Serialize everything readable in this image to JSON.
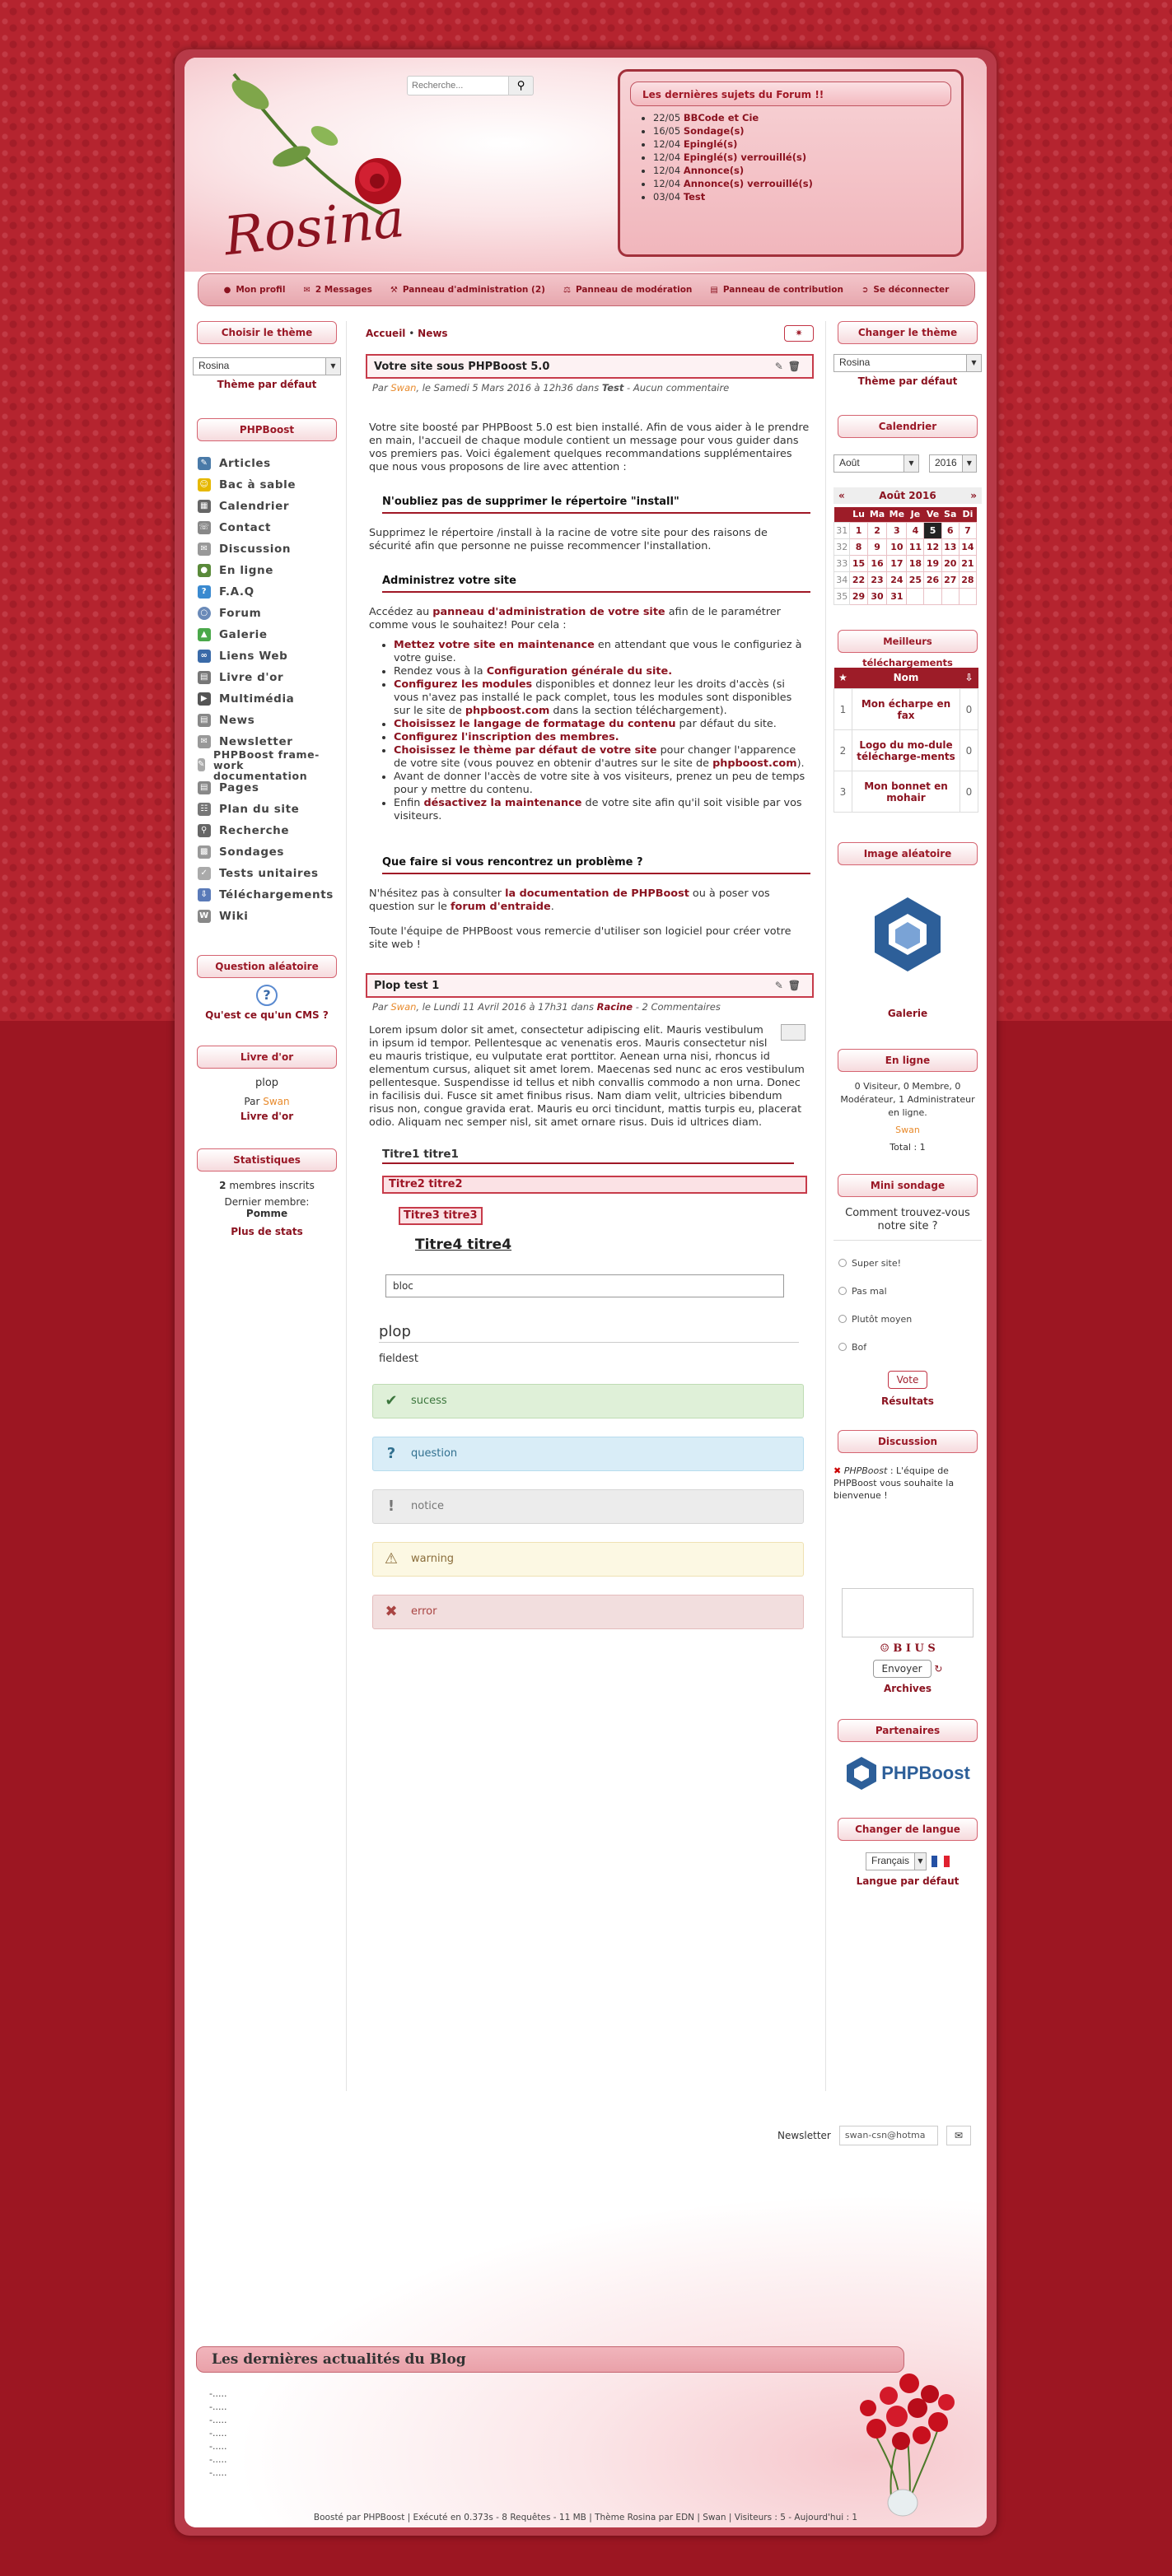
{
  "header": {
    "logo": "Rosina",
    "search_placeholder": "Recherche...",
    "forum_title": "Les dernières sujets du Forum !!",
    "forum_items": [
      {
        "date": "22/05",
        "title": "BBCode et Cie"
      },
      {
        "date": "16/05",
        "title": "Sondage(s)"
      },
      {
        "date": "12/04",
        "title": "Epinglé(s)"
      },
      {
        "date": "12/04",
        "title": "Epinglé(s) verrouillé(s)"
      },
      {
        "date": "12/04",
        "title": "Annonce(s)"
      },
      {
        "date": "12/04",
        "title": "Annonce(s) verrouillé(s)"
      },
      {
        "date": "03/04",
        "title": "Test"
      }
    ]
  },
  "navbar": {
    "items": [
      "Mon profil",
      "2 Messages",
      "Panneau d'administration (2)",
      "Panneau de modération",
      "Panneau de contribution",
      "Se déconnecter"
    ]
  },
  "left": {
    "theme_title": "Choisir le thème",
    "theme_value": "Rosina",
    "theme_default": "Thème par défaut",
    "phpboost_title": "PHPBoost",
    "menu": [
      "Articles",
      "Bac à sable",
      "Calendrier",
      "Contact",
      "Discussion",
      "En ligne",
      "F.A.Q",
      "Forum",
      "Galerie",
      "Liens Web",
      "Livre d'or",
      "Multimédia",
      "News",
      "Newsletter",
      "PHPBoost frame-work documentation",
      "Pages",
      "Plan du site",
      "Recherche",
      "Sondages",
      "Tests unitaires",
      "Téléchargements",
      "Wiki"
    ],
    "question_title": "Question aléatoire",
    "question_text": "Qu'est ce qu'un CMS ?",
    "guestbook_title": "Livre d'or",
    "guestbook_msg": "plop",
    "guestbook_by": "Par",
    "guestbook_user": "Swan",
    "guestbook_link": "Livre d'or",
    "stats_title": "Statistiques",
    "stats_members": "2",
    "stats_members_label": "membres inscrits",
    "stats_last": "Dernier membre:",
    "stats_last_name": "Pomme",
    "stats_more": "Plus de stats"
  },
  "main": {
    "crumb_home": "Accueil",
    "crumb_sep": "•",
    "crumb_news": "News",
    "a1": {
      "title": "Votre site sous PHPBoost 5.0",
      "meta_prefix": "Par",
      "user": "Swan",
      "meta_mid": ", le Samedi 5 Mars 2016 à 12h36 dans",
      "cat": "Test",
      "meta_end": "- Aucun commentaire",
      "p1": "Votre site boosté par PHPBoost 5.0 est bien installé. Afin de vous aider à le prendre en main, l'accueil de chaque module contient un message pour vous guider dans vos premiers pas. Voici également quelques recommandations supplémentaires que nous vous proposons de lire avec attention :",
      "h1": "N'oubliez pas de supprimer le répertoire \"install\"",
      "p2": "Supprimez le répertoire /install à la racine de votre site pour des raisons de sécurité afin que personne ne puisse recommencer l'installation.",
      "h2": "Administrez votre site",
      "p3a": "Accédez au",
      "p3link": "panneau d'administration de votre site",
      "p3b": "afin de le paramétrer comme vous le souhaitez! Pour cela :",
      "li1a": "Mettez votre site en maintenance",
      "li1b": "en attendant que vous le configuriez à votre guise.",
      "li2a": "Rendez vous à la",
      "li2b": "Configuration générale du site.",
      "li3a": "Configurez les modules",
      "li3b": "disponibles et donnez leur les droits d'accès (si vous n'avez pas installé le pack complet, tous les modules sont disponibles sur le site de",
      "li3c": "phpboost.com",
      "li3d": "dans la section téléchargement).",
      "li4a": "Choisissez le langage de formatage du contenu",
      "li4b": "par défaut du site.",
      "li5a": "Configurez l'inscription des membres.",
      "li6a": "Choisissez le thème par défaut de votre site",
      "li6b": "pour changer l'apparence de votre site (vous pouvez en obtenir d'autres sur le site de",
      "li6c": "phpboost.com",
      "li6d": ").",
      "li7": "Avant de donner l'accès de votre site à vos visiteurs, prenez un peu de temps pour y mettre du contenu.",
      "li8a": "Enfin",
      "li8b": "désactivez la maintenance",
      "li8c": "de votre site afin qu'il soit visible par vos visiteurs.",
      "h3": "Que faire si vous rencontrez un problème ?",
      "p4a": "N'hésitez pas à consulter",
      "p4b": "la documentation de PHPBoost",
      "p4c": "ou à poser vos question sur le",
      "p4d": "forum d'entraide",
      "p5": "Toute l'équipe de PHPBoost vous remercie d'utiliser son logiciel pour créer votre site web !"
    },
    "a2": {
      "title": "Plop test 1",
      "meta_prefix": "Par",
      "user": "Swan",
      "meta_mid": ", le Lundi 11 Avril 2016 à 17h31 dans",
      "cat": "Racine",
      "meta_end": "- 2 Commentaires",
      "lorem": "Lorem ipsum dolor sit amet, consectetur adipiscing elit. Mauris vestibulum in ipsum id tempor. Pellentesque ac venenatis eros. Mauris consectetur nisl eu mauris tristique, eu vulputate erat porttitor. Aenean urna nisi, rhoncus id elementum cursus, aliquet sit amet lorem. Maecenas sed nunc ac eros vestibulum pellentesque. Suspendisse id tellus et nibh convallis commodo a non urna. Donec in facilisis dui. Fusce sit amet finibus risus. Nam diam velit, ultricies bibendum risus non, congue gravida erat. Mauris eu orci tincidunt, mattis turpis eu, placerat odio. Aliquam nec semper nisl, sit amet ornare risus. Duis id ultrices diam.",
      "t1": "Titre1 titre1",
      "t2": "Titre2 titre2",
      "t3": "Titre3 titre3",
      "t4": "Titre4 titre4",
      "bloc": "bloc",
      "plop": "plop",
      "fieldset": "fieldest",
      "success": "sucess",
      "question": "question",
      "notice": "notice",
      "warning": "warning",
      "error": "error"
    }
  },
  "right": {
    "theme_title": "Changer le thème",
    "theme_value": "Rosina",
    "theme_default": "Thème par défaut",
    "cal_title": "Calendrier",
    "cal_month": "Août",
    "cal_year": "2016",
    "cal_label": "Août 2016",
    "cal_prev": "«",
    "cal_next": "»",
    "cal_days": [
      "Lu",
      "Ma",
      "Me",
      "Je",
      "Ve",
      "Sa",
      "Di"
    ],
    "cal_rows": [
      [
        "31",
        "1",
        "2",
        "3",
        "4",
        "5",
        "6",
        "7"
      ],
      [
        "32",
        "8",
        "9",
        "10",
        "11",
        "12",
        "13",
        "14"
      ],
      [
        "33",
        "15",
        "16",
        "17",
        "18",
        "19",
        "20",
        "21"
      ],
      [
        "34",
        "22",
        "23",
        "24",
        "25",
        "26",
        "27",
        "28"
      ],
      [
        "35",
        "29",
        "30",
        "31",
        "",
        "",
        "",
        ""
      ]
    ],
    "dl_title": "Meilleurs téléchargements",
    "dl_col": "Nom",
    "dl_rows": [
      {
        "n": "1",
        "name": "Mon écharpe en fax",
        "c": "0"
      },
      {
        "n": "2",
        "name": "Logo du mo-dule télécharge-ments",
        "c": "0"
      },
      {
        "n": "3",
        "name": "Mon bonnet en mohair",
        "c": "0"
      }
    ],
    "img_title": "Image aléatoire",
    "img_link": "Galerie",
    "online_title": "En ligne",
    "online_text": "0 Visiteur, 0 Membre, 0 Modérateur, 1 Administrateur en ligne.",
    "online_user": "Swan",
    "online_total": "Total : 1",
    "poll_title": "Mini sondage",
    "poll_q": "Comment trouvez-vous notre site ?",
    "poll_opts": [
      "Super site!",
      "Pas mal",
      "Plutôt moyen",
      "Bof"
    ],
    "poll_vote": "Vote",
    "poll_results": "Résultats",
    "disc_title": "Discussion",
    "disc_user": "PHPBoost",
    "disc_msg": ": L'équipe de PHPBoost vous souhaite la bienvenue !",
    "disc_send": "Envoyer",
    "disc_archives": "Archives",
    "disc_toolbar": "☺ B I U S",
    "partners_title": "Partenaires",
    "partners_logo": "PHPBoost",
    "lang_title": "Changer de langue",
    "lang_value": "Français",
    "lang_default": "Langue par défaut"
  },
  "footer": {
    "newsletter_label": "Newsletter",
    "newsletter_value": "swan-csn@hotma",
    "blog_title": "Les dernières actualités du Blog",
    "blog_items": [
      "-.....",
      "-.....",
      "-.....",
      "-.....",
      "-.....",
      "-.....",
      "-....."
    ],
    "credits": "Boosté par PHPBoost | Exécuté en 0.373s - 8 Requêtes - 11 MB | Thème Rosina par EDN | Swan | Visiteurs : 5 - Aujourd'hui : 1"
  }
}
